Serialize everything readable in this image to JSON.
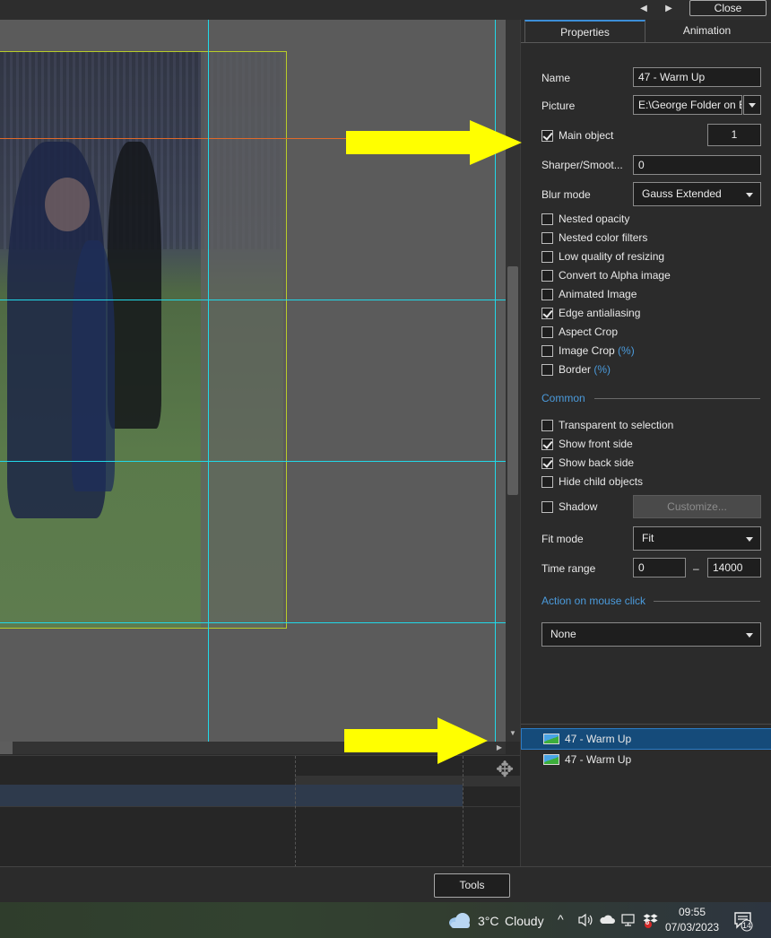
{
  "topbar": {
    "prev_icon": "◀",
    "next_icon": "▶",
    "close_label": "Close"
  },
  "tabs": [
    {
      "label": "Properties",
      "active": true
    },
    {
      "label": "Animation",
      "active": false
    }
  ],
  "properties": {
    "name_label": "Name",
    "name_value": "47 - Warm Up",
    "picture_label": "Picture",
    "picture_value": "E:\\George Folder on E\\",
    "main_object_label": "Main object",
    "main_object_checked": true,
    "main_object_value": "1",
    "sharper_label": "Sharper/Smoot...",
    "sharper_value": "0",
    "blur_label": "Blur mode",
    "blur_value": "Gauss Extended",
    "checkboxes": [
      {
        "label": "Nested opacity",
        "checked": false,
        "suffix": ""
      },
      {
        "label": "Nested color filters",
        "checked": false,
        "suffix": ""
      },
      {
        "label": "Low quality of resizing",
        "checked": false,
        "suffix": ""
      },
      {
        "label": "Convert to Alpha image",
        "checked": false,
        "suffix": ""
      },
      {
        "label": "Animated Image",
        "checked": false,
        "suffix": ""
      },
      {
        "label": "Edge antialiasing",
        "checked": true,
        "suffix": ""
      },
      {
        "label": "Aspect Crop",
        "checked": false,
        "suffix": ""
      },
      {
        "label": "Image Crop",
        "checked": false,
        "suffix": "(%)"
      },
      {
        "label": "Border",
        "checked": false,
        "suffix": "(%)"
      }
    ]
  },
  "common": {
    "title": "Common",
    "checkboxes": [
      {
        "label": "Transparent to selection",
        "checked": false
      },
      {
        "label": "Show front side",
        "checked": true
      },
      {
        "label": "Show back side",
        "checked": true
      },
      {
        "label": "Hide child objects",
        "checked": false
      }
    ],
    "shadow_label": "Shadow",
    "shadow_checked": false,
    "customize_label": "Customize...",
    "fit_label": "Fit mode",
    "fit_value": "Fit",
    "time_label": "Time range",
    "time_from": "0",
    "time_dash": "–",
    "time_to": "14000"
  },
  "action": {
    "title": "Action on mouse click",
    "value": "None"
  },
  "objects": [
    {
      "label": "47 - Warm Up",
      "selected": true
    },
    {
      "label": "47 - Warm Up",
      "selected": false
    }
  ],
  "bottombar": {
    "tools_label": "Tools"
  },
  "taskbar": {
    "weather_temp": "3°C",
    "weather_text": "Cloudy",
    "chevron_icon": "^",
    "badge_count": "6",
    "time": "09:55",
    "date": "07/03/2023",
    "notification_count": "14"
  },
  "colors": {
    "accent": "#4b9bdc",
    "guide": "#21d8e8",
    "crop": "#b8cc2a",
    "arrow": "#ffff00",
    "selected": "#154b7a"
  }
}
